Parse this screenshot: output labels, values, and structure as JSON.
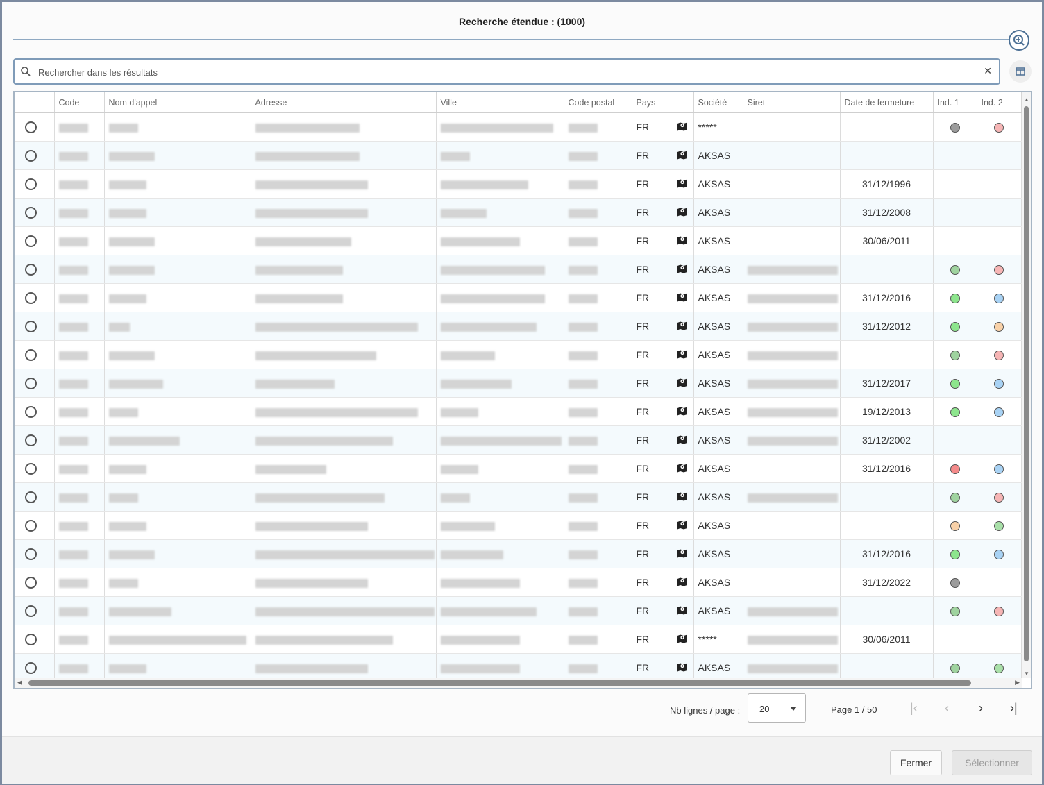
{
  "dialog": {
    "title": "Recherche étendue : (1000)",
    "search_placeholder": "Rechercher dans les résultats",
    "clear_label": "✕"
  },
  "columns": [
    "",
    "Code",
    "Nom d'appel",
    "Adresse",
    "Ville",
    "Code postal",
    "Pays",
    "",
    "Société",
    "Siret",
    "Date de fermeture",
    "Ind. 1",
    "Ind. 2"
  ],
  "rows": [
    {
      "pays": "FR",
      "societe": "*****",
      "date": "",
      "ind1": "#9c9c9c",
      "ind2": "#f6b5b5",
      "siret": false
    },
    {
      "pays": "FR",
      "societe": "AKSAS",
      "date": "",
      "ind1": "",
      "ind2": "",
      "siret": false
    },
    {
      "pays": "FR",
      "societe": "AKSAS",
      "date": "31/12/1996",
      "ind1": "",
      "ind2": "",
      "siret": false
    },
    {
      "pays": "FR",
      "societe": "AKSAS",
      "date": "31/12/2008",
      "ind1": "",
      "ind2": "",
      "siret": false
    },
    {
      "pays": "FR",
      "societe": "AKSAS",
      "date": "30/06/2011",
      "ind1": "",
      "ind2": "",
      "siret": false
    },
    {
      "pays": "FR",
      "societe": "AKSAS",
      "date": "",
      "ind1": "#9fd39f",
      "ind2": "#f6b5b5",
      "siret": true
    },
    {
      "pays": "FR",
      "societe": "AKSAS",
      "date": "31/12/2016",
      "ind1": "#8de58d",
      "ind2": "#a8d2f4",
      "siret": true
    },
    {
      "pays": "FR",
      "societe": "AKSAS",
      "date": "31/12/2012",
      "ind1": "#8de58d",
      "ind2": "#f8d1a8",
      "siret": true
    },
    {
      "pays": "FR",
      "societe": "AKSAS",
      "date": "",
      "ind1": "#9fd39f",
      "ind2": "#f6b5b5",
      "siret": true
    },
    {
      "pays": "FR",
      "societe": "AKSAS",
      "date": "31/12/2017",
      "ind1": "#8de58d",
      "ind2": "#a8d2f4",
      "siret": true
    },
    {
      "pays": "FR",
      "societe": "AKSAS",
      "date": "19/12/2013",
      "ind1": "#8de58d",
      "ind2": "#a8d2f4",
      "siret": true
    },
    {
      "pays": "FR",
      "societe": "AKSAS",
      "date": "31/12/2002",
      "ind1": "",
      "ind2": "",
      "siret": true
    },
    {
      "pays": "FR",
      "societe": "AKSAS",
      "date": "31/12/2016",
      "ind1": "#f48a8a",
      "ind2": "#a8d2f4",
      "siret": false
    },
    {
      "pays": "FR",
      "societe": "AKSAS",
      "date": "",
      "ind1": "#9fd39f",
      "ind2": "#f6b5b5",
      "siret": true
    },
    {
      "pays": "FR",
      "societe": "AKSAS",
      "date": "",
      "ind1": "#f8d1a8",
      "ind2": "#a9e0a9",
      "siret": false
    },
    {
      "pays": "FR",
      "societe": "AKSAS",
      "date": "31/12/2016",
      "ind1": "#8de58d",
      "ind2": "#a8d2f4",
      "siret": false
    },
    {
      "pays": "FR",
      "societe": "AKSAS",
      "date": "31/12/2022",
      "ind1": "#9c9c9c",
      "ind2": "",
      "siret": false
    },
    {
      "pays": "FR",
      "societe": "AKSAS",
      "date": "",
      "ind1": "#9fd39f",
      "ind2": "#f6b5b5",
      "siret": true
    },
    {
      "pays": "FR",
      "societe": "*****",
      "date": "30/06/2011",
      "ind1": "",
      "ind2": "",
      "siret": true
    },
    {
      "pays": "FR",
      "societe": "AKSAS",
      "date": "",
      "ind1": "#9fd39f",
      "ind2": "#a9e0a9",
      "siret": true
    }
  ],
  "pagination": {
    "rows_per_page_label": "Nb lignes / page :",
    "rows_per_page_value": "20",
    "page_info": "Page 1 / 50",
    "first_icon": "first-page-icon",
    "prev_icon": "prev-page-icon",
    "next_icon": "next-page-icon",
    "last_icon": "last-page-icon"
  },
  "footer": {
    "close_label": "Fermer",
    "select_label": "Sélectionner"
  }
}
